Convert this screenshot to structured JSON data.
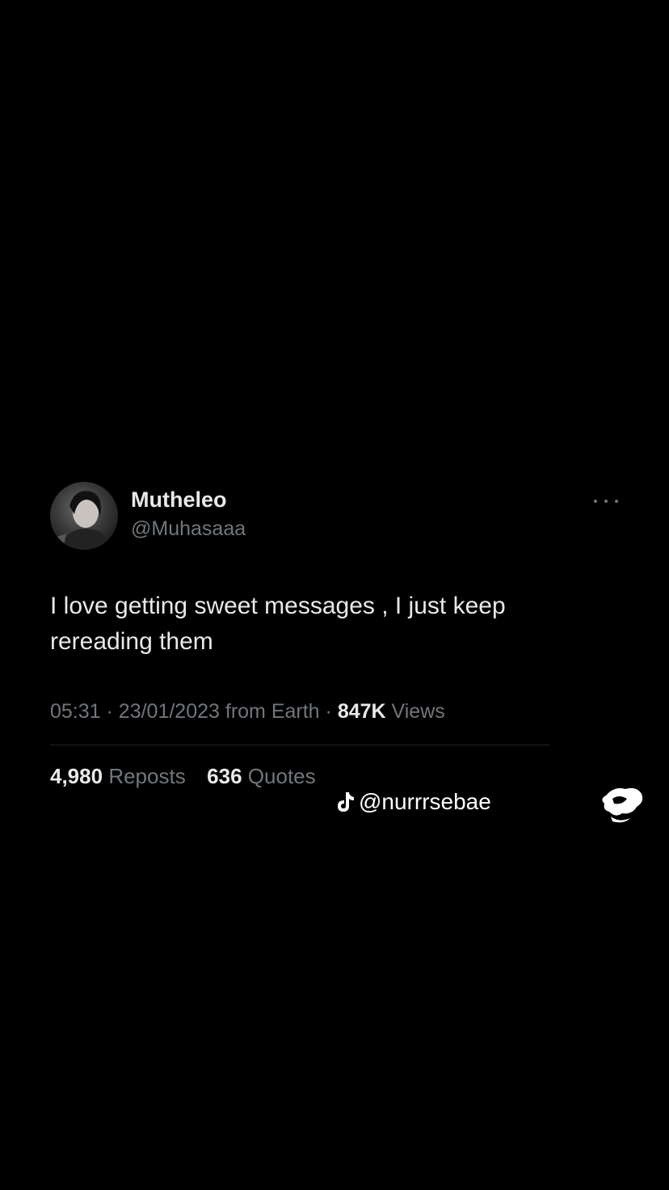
{
  "tweet": {
    "display_name": "Mutheleo",
    "handle": "@Muhasaaa",
    "text": "I love getting sweet messages , I just keep rereading them",
    "time": "05:31",
    "date": "23/01/2023",
    "source": "from Earth",
    "views_count": "847K",
    "views_label": "Views",
    "reposts_count": "4,980",
    "reposts_label": "Reposts",
    "quotes_count": "636",
    "quotes_label": "Quotes"
  },
  "watermark": {
    "username": "@nurrrsebae"
  },
  "icons": {
    "more": "more-horizontal-icon",
    "tiktok": "tiktok-logo-icon",
    "corner": "tiktok-corner-logo-icon"
  },
  "colors": {
    "background": "#000000",
    "primary_text": "#e7e9ea",
    "secondary_text": "#71767b"
  }
}
